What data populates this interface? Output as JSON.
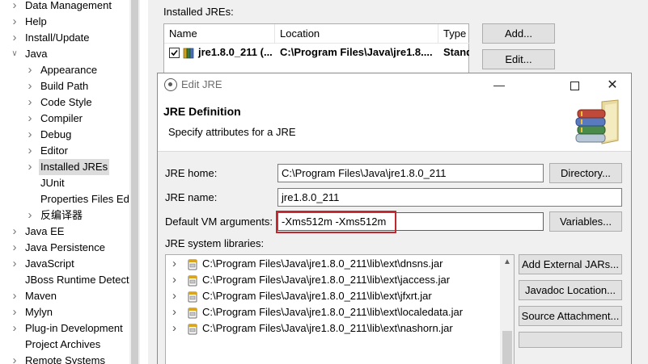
{
  "tree": {
    "items": [
      {
        "label": "Data Management",
        "expandable": true
      },
      {
        "label": "Help",
        "expandable": true
      },
      {
        "label": "Install/Update",
        "expandable": true
      },
      {
        "label": "Java",
        "expandable": true,
        "expanded": true
      },
      {
        "label": "Appearance",
        "expandable": true
      },
      {
        "label": "Build Path",
        "expandable": true
      },
      {
        "label": "Code Style",
        "expandable": true
      },
      {
        "label": "Compiler",
        "expandable": true
      },
      {
        "label": "Debug",
        "expandable": true
      },
      {
        "label": "Editor",
        "expandable": true
      },
      {
        "label": "Installed JREs",
        "expandable": true,
        "selected": true
      },
      {
        "label": "JUnit",
        "expandable": false
      },
      {
        "label": "Properties Files Ed",
        "expandable": false
      },
      {
        "label": "反编译器",
        "expandable": true
      },
      {
        "label": "Java EE",
        "expandable": true
      },
      {
        "label": "Java Persistence",
        "expandable": true
      },
      {
        "label": "JavaScript",
        "expandable": true
      },
      {
        "label": "JBoss Runtime Detect",
        "expandable": false
      },
      {
        "label": "Maven",
        "expandable": true
      },
      {
        "label": "Mylyn",
        "expandable": true
      },
      {
        "label": "Plug-in Development",
        "expandable": true
      },
      {
        "label": "Project Archives",
        "expandable": false
      },
      {
        "label": "Remote Systems",
        "expandable": true
      }
    ]
  },
  "installed": {
    "label": "Installed JREs:",
    "columns": [
      "Name",
      "Location",
      "Type"
    ],
    "rows": [
      {
        "name": "jre1.8.0_211 (...",
        "location": "C:\\Program Files\\Java\\jre1.8....",
        "type": "Standa..."
      }
    ],
    "add_label": "Add...",
    "edit_label": "Edit..."
  },
  "dialog": {
    "title": "Edit JRE",
    "heading": "JRE Definition",
    "description": "Specify attributes for a JRE",
    "jre_home_label": "JRE home:",
    "jre_home_value": "C:\\Program Files\\Java\\jre1.8.0_211",
    "directory_label": "Directory...",
    "jre_name_label": "JRE name:",
    "jre_name_value": "jre1.8.0_211",
    "vm_args_label": "Default VM arguments:",
    "vm_args_value": "-Xms512m -Xms512m",
    "variables_label": "Variables...",
    "libs_label": "JRE system libraries:",
    "libs": [
      "C:\\Program Files\\Java\\jre1.8.0_211\\lib\\ext\\dnsns.jar",
      "C:\\Program Files\\Java\\jre1.8.0_211\\lib\\ext\\jaccess.jar",
      "C:\\Program Files\\Java\\jre1.8.0_211\\lib\\ext\\jfxrt.jar",
      "C:\\Program Files\\Java\\jre1.8.0_211\\lib\\ext\\localedata.jar",
      "C:\\Program Files\\Java\\jre1.8.0_211\\lib\\ext\\nashorn.jar"
    ],
    "add_jars_label": "Add External JARs...",
    "javadoc_label": "Javadoc Location...",
    "source_label": "Source Attachment..."
  },
  "colors": {
    "highlight": "#c0282d",
    "focus_border": "#0078d7",
    "selection": "#dcdcdc"
  }
}
